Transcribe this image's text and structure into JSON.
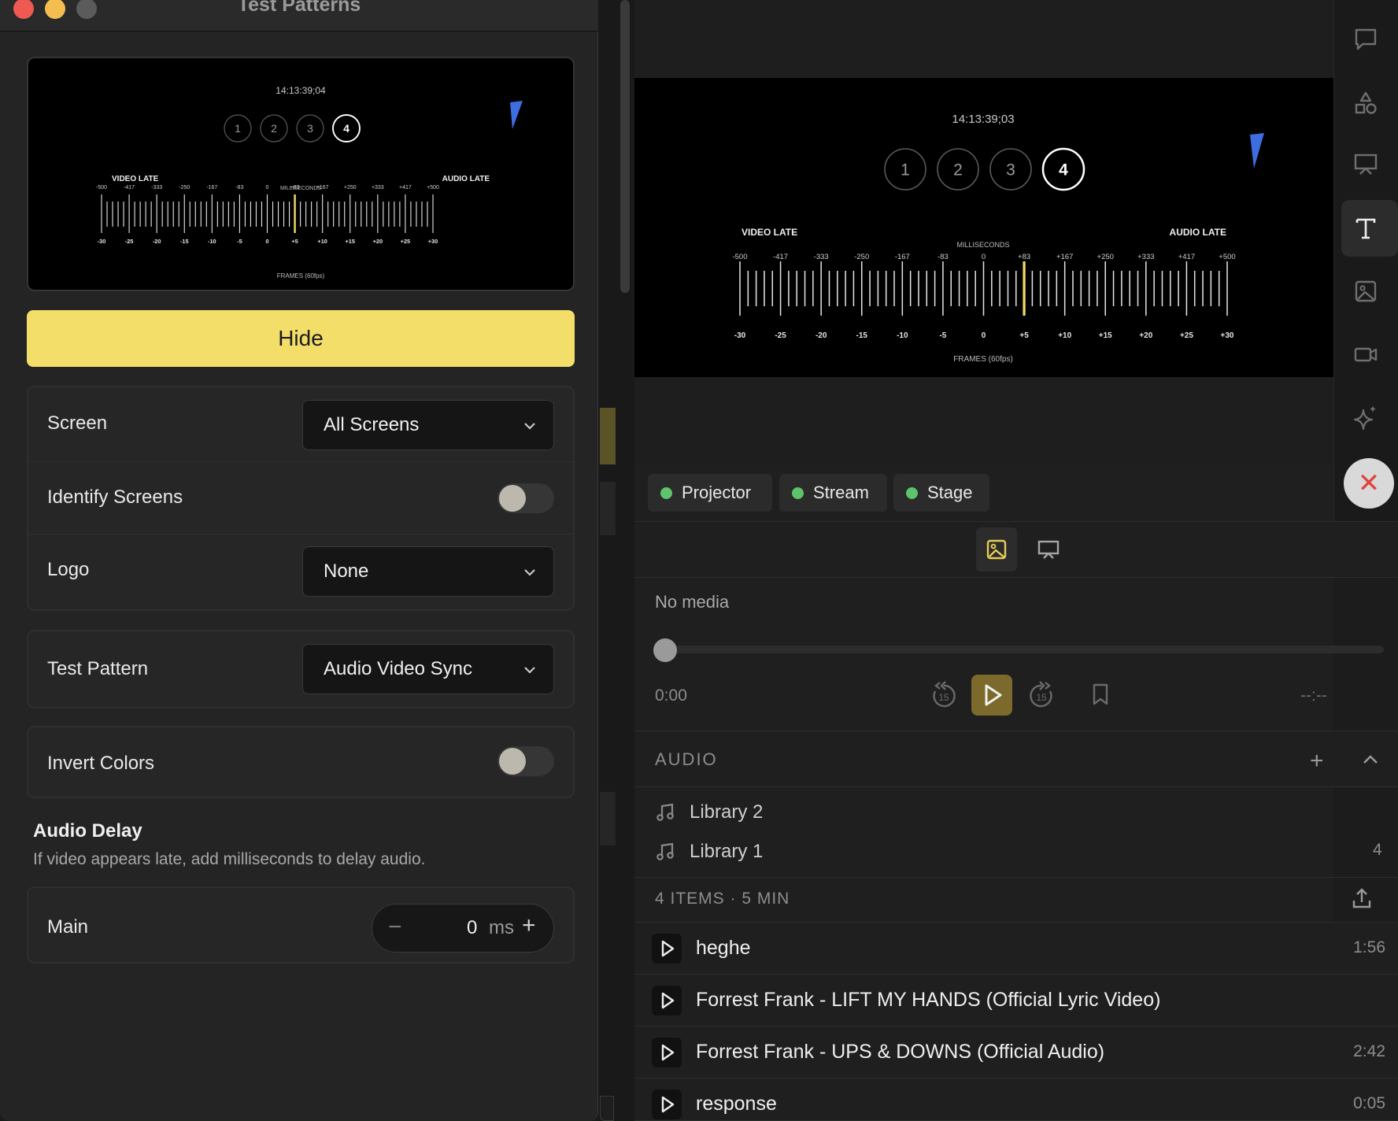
{
  "window": {
    "title": "Test Patterns",
    "traffic_lights": {
      "close": "#ee5a52",
      "minimize": "#f4bd4f",
      "zoom": "#5b5b5b"
    }
  },
  "pattern": {
    "timecode": "14:13:39;04",
    "beats": [
      "1",
      "2",
      "3",
      "4"
    ],
    "active_beat": "4",
    "video_late": "VIDEO LATE",
    "audio_late": "AUDIO LATE",
    "milliseconds": "MILLISECONDS",
    "ms_ticks": [
      "-500",
      "-417",
      "-333",
      "-250",
      "-167",
      "-83",
      "0",
      "+83",
      "+167",
      "+250",
      "+333",
      "+417",
      "+500"
    ],
    "frame_ticks": [
      "-30",
      "-25",
      "-20",
      "-15",
      "-10",
      "-5",
      "0",
      "+5",
      "+10",
      "+15",
      "+20",
      "+25",
      "+30"
    ],
    "frames_label": "FRAMES (60fps)"
  },
  "preview": {
    "timecode": "14:13:39;03"
  },
  "hide_button": "Hide",
  "settings": {
    "screen_label": "Screen",
    "screen_value": "All Screens",
    "identify_label": "Identify Screens",
    "identify_on": false,
    "logo_label": "Logo",
    "logo_value": "None",
    "test_pattern_label": "Test Pattern",
    "test_pattern_value": "Audio Video Sync",
    "invert_label": "Invert Colors",
    "invert_on": false
  },
  "audio_delay": {
    "title": "Audio Delay",
    "description": "If video appears late, add milliseconds to delay audio.",
    "main_label": "Main",
    "value": "0",
    "unit": "ms",
    "minus": "−",
    "plus": "+"
  },
  "outputs": [
    {
      "label": "Projector",
      "status_color": "#5ec46b"
    },
    {
      "label": "Stream",
      "status_color": "#5ec46b"
    },
    {
      "label": "Stage",
      "status_color": "#5ec46b"
    }
  ],
  "player": {
    "no_media": "No media",
    "current_time": "0:00",
    "end_time": "--:--",
    "skip_back": "15",
    "skip_forward": "15"
  },
  "audio": {
    "title": "AUDIO",
    "add": "+",
    "libraries": [
      {
        "name": "Library 2",
        "count": ""
      },
      {
        "name": "Library 1",
        "count": "4"
      }
    ],
    "summary": "4 ITEMS · 5 MIN",
    "tracks": [
      {
        "title": "heghe",
        "duration": "1:56"
      },
      {
        "title": "Forrest Frank - LIFT MY HANDS (Official Lyric Video)",
        "duration": ""
      },
      {
        "title": "Forrest Frank - UPS & DOWNS (Official Audio)",
        "duration": "2:42"
      },
      {
        "title": "response",
        "duration": "0:05"
      }
    ]
  },
  "colors": {
    "accent": "#f4de6a",
    "sync_marker": "#f1d96b",
    "flag": "#3d6ee0"
  }
}
